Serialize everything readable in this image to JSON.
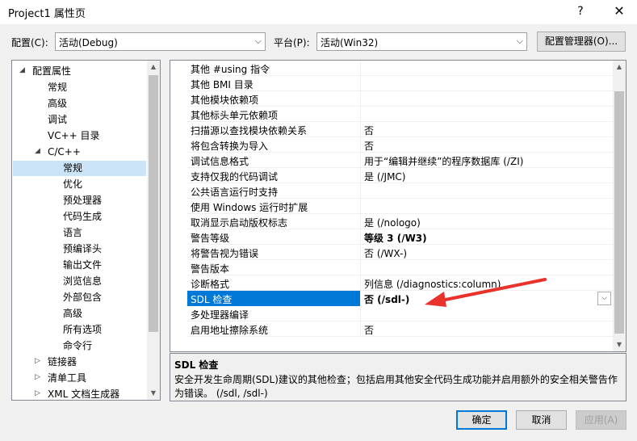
{
  "window": {
    "title": "Project1 属性页",
    "help_glyph": "?",
    "close_glyph": "✕"
  },
  "toolbar": {
    "config_label": "配置(C):",
    "config_value": "活动(Debug)",
    "platform_label": "平台(P):",
    "platform_value": "活动(Win32)",
    "config_manager_label": "配置管理器(O)..."
  },
  "tree": [
    {
      "label": "配置属性",
      "level": 0,
      "expander": "◢"
    },
    {
      "label": "常规",
      "level": 1
    },
    {
      "label": "高级",
      "level": 1
    },
    {
      "label": "调试",
      "level": 1
    },
    {
      "label": "VC++ 目录",
      "level": 1
    },
    {
      "label": "C/C++",
      "level": 1,
      "expander": "◢"
    },
    {
      "label": "常规",
      "level": 2,
      "selected": true
    },
    {
      "label": "优化",
      "level": 2
    },
    {
      "label": "预处理器",
      "level": 2
    },
    {
      "label": "代码生成",
      "level": 2
    },
    {
      "label": "语言",
      "level": 2
    },
    {
      "label": "预编译头",
      "level": 2
    },
    {
      "label": "输出文件",
      "level": 2
    },
    {
      "label": "浏览信息",
      "level": 2
    },
    {
      "label": "外部包含",
      "level": 2
    },
    {
      "label": "高级",
      "level": 2
    },
    {
      "label": "所有选项",
      "level": 2
    },
    {
      "label": "命令行",
      "level": 2
    },
    {
      "label": "链接器",
      "level": 1,
      "expander": "▷"
    },
    {
      "label": "清单工具",
      "level": 1,
      "expander": "▷"
    },
    {
      "label": "XML 文档生成器",
      "level": 1,
      "expander": "▷"
    }
  ],
  "properties": [
    {
      "name": "其他 #using 指令",
      "value": ""
    },
    {
      "name": "其他 BMI 目录",
      "value": ""
    },
    {
      "name": "其他模块依赖项",
      "value": ""
    },
    {
      "name": "其他标头单元依赖项",
      "value": ""
    },
    {
      "name": "扫描源以查找模块依赖关系",
      "value": "否"
    },
    {
      "name": "将包含转换为导入",
      "value": "否"
    },
    {
      "name": "调试信息格式",
      "value": "用于“编辑并继续”的程序数据库 (/ZI)"
    },
    {
      "name": "支持仅我的代码调试",
      "value": "是 (/JMC)"
    },
    {
      "name": "公共语言运行时支持",
      "value": ""
    },
    {
      "name": "使用 Windows 运行时扩展",
      "value": ""
    },
    {
      "name": "取消显示启动版权标志",
      "value": "是 (/nologo)"
    },
    {
      "name": "警告等级",
      "value": "等级 3 (/W3)",
      "bold": true
    },
    {
      "name": "将警告视为错误",
      "value": "否 (/WX-)"
    },
    {
      "name": "警告版本",
      "value": ""
    },
    {
      "name": "诊断格式",
      "value": "列信息 (/diagnostics:column)"
    },
    {
      "name": "SDL 检查",
      "value": "否 (/sdl-)",
      "selected": true
    },
    {
      "name": "多处理器编译",
      "value": ""
    },
    {
      "name": "启用地址擦除系统",
      "value": "否"
    }
  ],
  "description": {
    "title": "SDL 检查",
    "line1": "安全开发生命周期(SDL)建议的其他检查；包括启用其他安全代码生成功能并启用额外的安全相关警告作",
    "line2": "为错误。    (/sdl, /sdl-)"
  },
  "buttons": {
    "ok": "确定",
    "cancel": "取消",
    "apply": "应用(A)"
  },
  "colors": {
    "selection": "#0078d7",
    "tree_selection": "#cce4f7",
    "annotation_arrow": "#e8322b"
  }
}
